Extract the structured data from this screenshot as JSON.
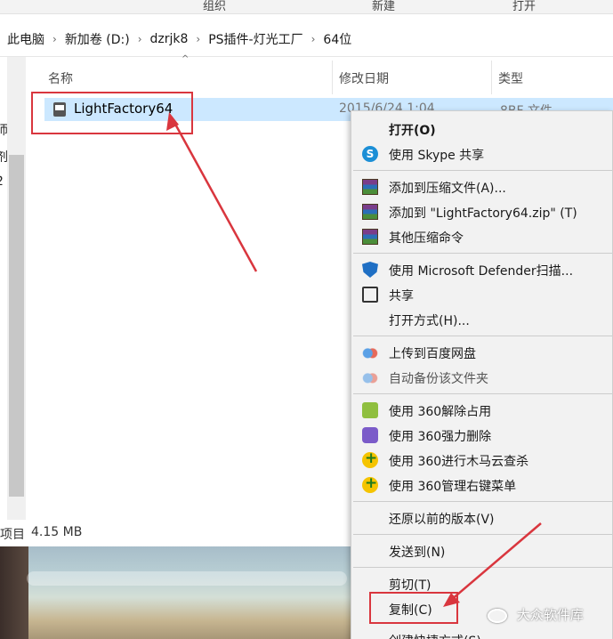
{
  "ribbon": {
    "groups": [
      "组织",
      "新建",
      "打开"
    ]
  },
  "breadcrumb": [
    "此电脑",
    "新加卷 (D:)",
    "dzrjk8",
    "PS插件-灯光工厂",
    "64位"
  ],
  "nav_partial_chars": [
    "师",
    "剂",
    "2"
  ],
  "columns": {
    "name": "名称",
    "modified": "修改日期",
    "type": "类型"
  },
  "file": {
    "name": "LightFactory64",
    "modified": "2015/6/24 1:04",
    "type": "8BF 文件"
  },
  "status": {
    "items_label": "项目",
    "size": "4.15 MB"
  },
  "context_menu": {
    "items": [
      {
        "label": "打开(O)",
        "icon": "none",
        "bold": true
      },
      {
        "label": "使用 Skype 共享",
        "icon": "skype-icon"
      },
      {
        "label": "添加到压缩文件(A)...",
        "icon": "winrar-icon"
      },
      {
        "label": "添加到 \"LightFactory64.zip\" (T)",
        "icon": "winrar-icon"
      },
      {
        "label": "其他压缩命令",
        "icon": "winrar-icon"
      },
      {
        "label": "使用 Microsoft Defender扫描...",
        "icon": "defender-shield-icon"
      },
      {
        "label": "共享",
        "icon": "share-icon"
      },
      {
        "label": "打开方式(H)...",
        "icon": "none"
      },
      {
        "label": "上传到百度网盘",
        "icon": "baidu-cloud-icon"
      },
      {
        "label": "自动备份该文件夹",
        "icon": "baidu-cloud-icon",
        "dim": true
      },
      {
        "label": "使用 360解除占用",
        "icon": "360-unlock-icon"
      },
      {
        "label": "使用 360强力删除",
        "icon": "360-delete-icon"
      },
      {
        "label": "使用 360进行木马云查杀",
        "icon": "360-scan-icon"
      },
      {
        "label": "使用 360管理右键菜单",
        "icon": "360-menu-icon"
      },
      {
        "label": "还原以前的版本(V)",
        "icon": "none"
      },
      {
        "label": "发送到(N)",
        "icon": "none"
      },
      {
        "label": "剪切(T)",
        "icon": "none"
      },
      {
        "label": "复制(C)",
        "icon": "none"
      },
      {
        "label": "创建快捷方式(S)",
        "icon": "none"
      }
    ]
  },
  "watermark": {
    "text": "大众软件库"
  },
  "colors": {
    "annotation_red": "#d9363e",
    "selection_blue": "#cce8ff",
    "menu_bg": "#f2f2f2"
  }
}
